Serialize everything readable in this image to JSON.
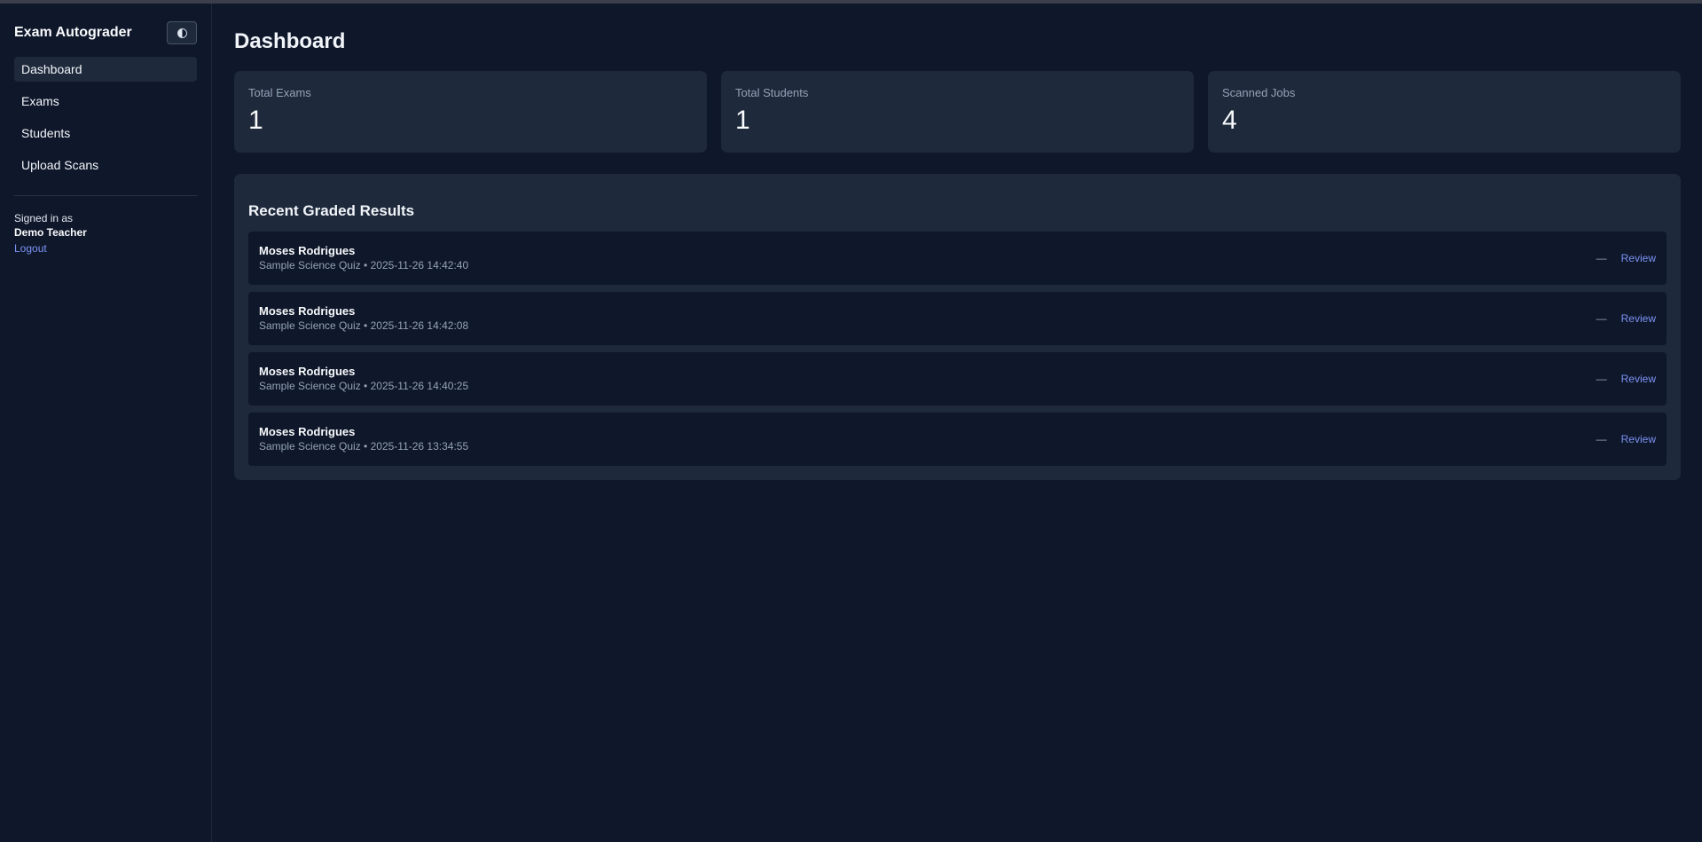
{
  "sidebar": {
    "brand": "Exam Autograder",
    "theme_icon": "half-circle-icon",
    "nav": [
      {
        "label": "Dashboard",
        "active": true
      },
      {
        "label": "Exams",
        "active": false
      },
      {
        "label": "Students",
        "active": false
      },
      {
        "label": "Upload Scans",
        "active": false
      }
    ],
    "signed_in_label": "Signed in as",
    "user_name": "Demo Teacher",
    "logout_label": "Logout"
  },
  "main": {
    "title": "Dashboard",
    "stats": [
      {
        "label": "Total Exams",
        "value": "1"
      },
      {
        "label": "Total Students",
        "value": "1"
      },
      {
        "label": "Scanned Jobs",
        "value": "4"
      }
    ],
    "results": {
      "title": "Recent Graded Results",
      "rows": [
        {
          "name": "Moses Rodrigues",
          "meta": "Sample Science Quiz • 2025-11-26 14:42:40",
          "score": "—",
          "action": "Review"
        },
        {
          "name": "Moses Rodrigues",
          "meta": "Sample Science Quiz • 2025-11-26 14:42:08",
          "score": "—",
          "action": "Review"
        },
        {
          "name": "Moses Rodrigues",
          "meta": "Sample Science Quiz • 2025-11-26 14:40:25",
          "score": "—",
          "action": "Review"
        },
        {
          "name": "Moses Rodrigues",
          "meta": "Sample Science Quiz • 2025-11-26 13:34:55",
          "score": "—",
          "action": "Review"
        }
      ]
    }
  },
  "colors": {
    "background": "#0f172a",
    "card": "#1e293b",
    "accent_link": "#7c93f5",
    "muted_text": "#94a3b8"
  }
}
